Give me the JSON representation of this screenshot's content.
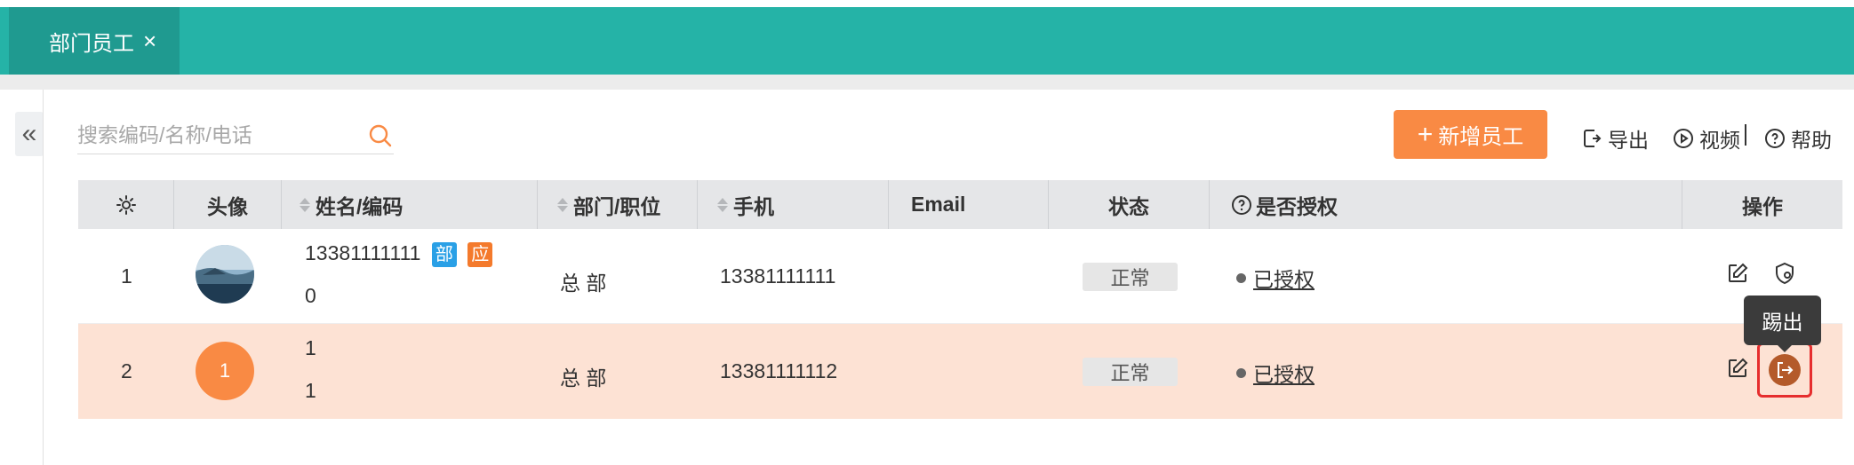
{
  "tabs": [
    {
      "label": "部门员工",
      "close": "×"
    }
  ],
  "collapse_icon": "«",
  "search": {
    "placeholder": "搜索编码/名称/电话"
  },
  "toolbar": {
    "add_plus": "+",
    "add_label": "新增员工",
    "export_label": "导出",
    "video_label": "视频",
    "help_label": "帮助"
  },
  "table": {
    "headers": {
      "avatar": "头像",
      "name": "姓名/编码",
      "dept": "部门/职位",
      "phone": "手机",
      "email": "Email",
      "status": "状态",
      "authorized": "是否授权",
      "actions": "操作"
    },
    "rows": [
      {
        "index": "1",
        "name": "13381111111",
        "code": "0",
        "badges": [
          "部",
          "应"
        ],
        "dept": "总 部",
        "phone": "13381111111",
        "email": "",
        "status": "正常",
        "auth": "已授权"
      },
      {
        "index": "2",
        "avatar_text": "1",
        "name": "1",
        "code": "1",
        "dept": "总 部",
        "phone": "13381111112",
        "email": "",
        "status": "正常",
        "auth": "已授权"
      }
    ]
  },
  "tooltip": {
    "text": "踢出"
  },
  "colors": {
    "header_teal": "#25b3a7",
    "accent_orange": "#f98a44",
    "row_highlight": "#fde2d4",
    "badge_blue": "#2aa0e6",
    "badge_orange": "#f47a2c"
  }
}
